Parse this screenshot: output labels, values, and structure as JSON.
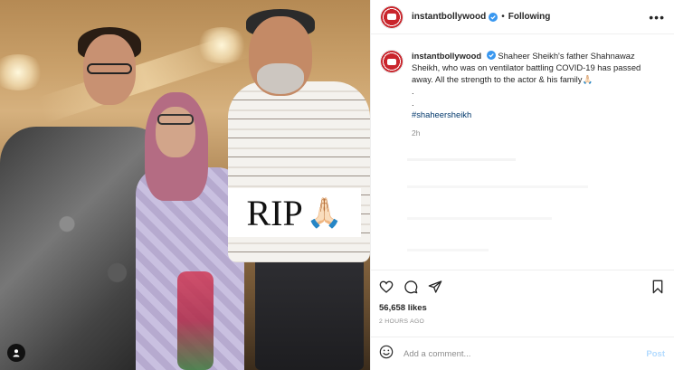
{
  "photo": {
    "overlay_text": "RIP",
    "overlay_emoji": "🙏🏻"
  },
  "header": {
    "username": "instantbollywood",
    "separator": "•",
    "follow_state": "Following",
    "more_label": "•••"
  },
  "caption": {
    "username": "instantbollywood",
    "text": "Shaheer Sheikh's father Shahnawaz Sheikh, who was on ventilator battling COVID-19 has passed away. All the strength to the actor & his family🙏🏻",
    "dot1": ".",
    "dot2": ".",
    "hashtag": "#shaheersheikh",
    "time": "2h"
  },
  "stats": {
    "likes": "56,658 likes",
    "posted": "2 HOURS AGO"
  },
  "comment": {
    "placeholder": "Add a comment...",
    "post_label": "Post"
  },
  "icons": [
    "heart-icon",
    "comment-icon",
    "share-icon",
    "bookmark-icon",
    "emoji-icon",
    "user-tag-icon",
    "verified-icon",
    "more-icon"
  ],
  "colors": {
    "link": "#00376b",
    "verified": "#3897f0",
    "muted": "#8e8e8e",
    "post_disabled": "#b3dbff",
    "brand_red": "#c9252c"
  }
}
